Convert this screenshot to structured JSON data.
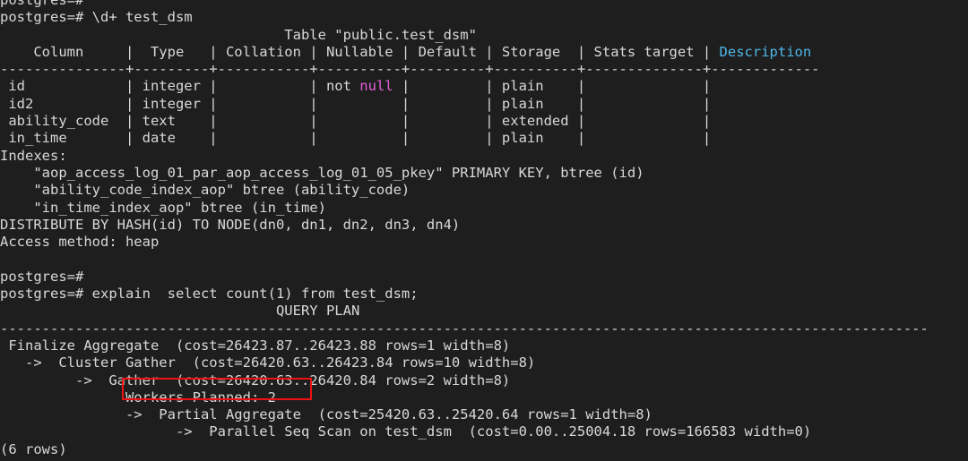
{
  "terminal": {
    "prompt": "postgres=#",
    "background_color": "#1e1e1e",
    "foreground_color": "#d8d8d8",
    "accent_null_color": "#e35fd8",
    "accent_header_color": "#4fb7e8",
    "highlight_box_color": "#ee1111",
    "highlight_box_target": "Workers Planned: 2"
  },
  "commands": {
    "describe": "postgres=# \\d+ test_dsm",
    "explain": "postgres=# explain  select count(1) from test_dsm;",
    "blank_prompt": "postgres=#",
    "partial_top_prompt": "postgres=#"
  },
  "describe_output": {
    "title": "Table \"public.test_dsm\"",
    "headers": [
      "Column",
      "Type",
      "Collation",
      "Nullable",
      "Default",
      "Storage",
      "Stats target",
      "Description"
    ],
    "header_line": "    Column     |  Type   | Collation | Nullable | Default | Storage  | Stats target | ",
    "header_description": "Description",
    "separator": "---------------+---------+-----------+----------+---------+----------+--------------+-------------",
    "rows": [
      {
        "pre": " id            | integer |           | not ",
        "null_token": "null",
        "post": " |         | plain    |              | "
      },
      {
        "pre": " id2           | integer |           |      ",
        "null_token": "",
        "post": "    |         | plain    |              | "
      },
      {
        "pre": " ability_code  | text    |           |      ",
        "null_token": "",
        "post": "    |         | extended |              | "
      },
      {
        "pre": " in_time       | date    |           |      ",
        "null_token": "",
        "post": "    |         | plain    |              | "
      }
    ],
    "indexes_label": "Indexes:",
    "indexes": [
      "    \"aop_access_log_01_par_aop_access_log_01_05_pkey\" PRIMARY KEY, btree (id)",
      "    \"ability_code_index_aop\" btree (ability_code)",
      "    \"in_time_index_aop\" btree (in_time)"
    ],
    "distribute": "DISTRIBUTE BY HASH(id) TO NODE(dn0, dn1, dn2, dn3, dn4)",
    "access_method": "Access method: heap"
  },
  "explain_output": {
    "plan_header": "QUERY PLAN",
    "plan_separator": "---------------------------------------------------------------------------------------------------------------",
    "plan_lines": [
      " Finalize Aggregate  (cost=26423.87..26423.88 rows=1 width=8)",
      "   ->  Cluster Gather  (cost=26420.63..26423.84 rows=10 width=8)",
      "         ->  Gather  (cost=26420.63..26420.84 rows=2 width=8)",
      "               Workers Planned: 2",
      "               ->  Partial Aggregate  (cost=25420.63..25420.64 rows=1 width=8)",
      "                     ->  Parallel Seq Scan on test_dsm  (cost=0.00..25004.18 rows=166583 width=0)"
    ],
    "row_count": "(6 rows)"
  },
  "chart_data": {
    "type": "table",
    "title": "Table \"public.test_dsm\"",
    "columns": [
      "Column",
      "Type",
      "Collation",
      "Nullable",
      "Default",
      "Storage",
      "Stats target",
      "Description"
    ],
    "rows": [
      [
        "id",
        "integer",
        "",
        "not null",
        "",
        "plain",
        "",
        ""
      ],
      [
        "id2",
        "integer",
        "",
        "",
        "",
        "plain",
        "",
        ""
      ],
      [
        "ability_code",
        "text",
        "",
        "",
        "",
        "extended",
        "",
        ""
      ],
      [
        "in_time",
        "date",
        "",
        "",
        "",
        "plain",
        "",
        ""
      ]
    ]
  }
}
